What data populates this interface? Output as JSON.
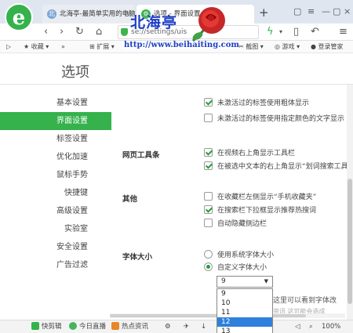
{
  "tabs": [
    {
      "title": "北海亭-最简单实用的电脑"
    },
    {
      "title": "选项 - 界面设置"
    }
  ],
  "toolbar": {
    "url": "se://settings/uis"
  },
  "bookmarks": {
    "favorites": "收藏",
    "extensions": "扩展",
    "screenshot": "截图",
    "games": "游戏",
    "login": "登录管家"
  },
  "watermark": {
    "title": "北海亭",
    "url": "http://www.beihaiting.com"
  },
  "page": {
    "title": "选项"
  },
  "sidebar": {
    "items": [
      {
        "label": "基本设置"
      },
      {
        "label": "界面设置"
      },
      {
        "label": "标签设置"
      },
      {
        "label": "优化加速"
      },
      {
        "label": "鼠标手势"
      },
      {
        "label": "快捷键"
      },
      {
        "label": "高级设置"
      },
      {
        "label": "实验室"
      },
      {
        "label": "安全设置"
      },
      {
        "label": "广告过滤"
      }
    ]
  },
  "content": {
    "tab_opts": [
      {
        "label": "未激活过的标签使用粗体显示",
        "checked": true
      },
      {
        "label": "未激活过的标签使用指定颜色的文字显示",
        "checked": false
      }
    ],
    "webtools": {
      "label": "网页工具条",
      "opts": [
        {
          "label": "在视频右上角显示工具栏",
          "checked": true
        },
        {
          "label": "在被选中文本的右上角显示“划词搜索工具",
          "checked": true
        }
      ]
    },
    "other": {
      "label": "其他",
      "opts": [
        {
          "label": "在收藏栏左侧显示“手机收藏夹”",
          "checked": false
        },
        {
          "label": "在搜索栏下拉框显示推荐热搜词",
          "checked": true
        },
        {
          "label": "自动隐藏侧边栏",
          "checked": false
        }
      ]
    },
    "font": {
      "label": "字体大小",
      "opts": [
        {
          "label": "使用系统字体大小",
          "selected": false
        },
        {
          "label": "自定义字体大小",
          "selected": true
        }
      ],
      "current": "9",
      "options": [
        "9",
        "10",
        "11",
        "12",
        "13"
      ],
      "highlighted": "12"
    },
    "partial_text": "器，这里可以看到字体改",
    "partial_text2": "资讯 这可能会造成"
  },
  "status": {
    "quick": "快剪辑",
    "live": "今日直播",
    "news": "热点资讯",
    "zoom": "100%"
  }
}
